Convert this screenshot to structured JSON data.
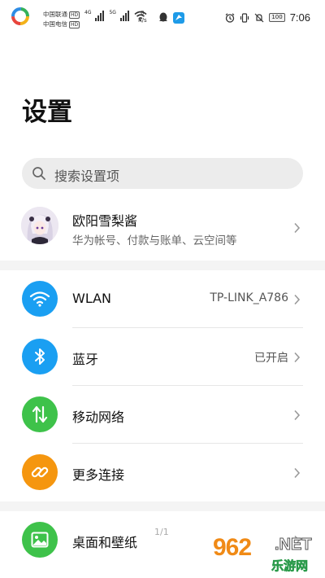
{
  "status_bar": {
    "carrier1": "中国联通",
    "carrier2": "中国电信",
    "hd": "HD",
    "net1": "4G",
    "net2": "5G",
    "speed_value": "0",
    "speed_unit": "K/s",
    "battery": "100",
    "time": "7:06"
  },
  "page": {
    "title": "设置"
  },
  "search": {
    "placeholder": "搜索设置项"
  },
  "account": {
    "name": "欧阳雪梨酱",
    "subtitle": "华为帐号、付款与账单、云空间等"
  },
  "rows": [
    {
      "label": "WLAN",
      "value": "TP-LINK_A786",
      "icon": "wifi-icon",
      "color": "#1a9ff2"
    },
    {
      "label": "蓝牙",
      "value": "已开启",
      "icon": "bluetooth-icon",
      "color": "#1a9ff2"
    },
    {
      "label": "移动网络",
      "value": "",
      "icon": "mobile-data-icon",
      "color": "#3ec24a"
    },
    {
      "label": "更多连接",
      "value": "",
      "icon": "link-icon",
      "color": "#f5960f"
    },
    {
      "label": "桌面和壁纸",
      "value": "",
      "icon": "wallpaper-icon",
      "color": "#3ec24a"
    }
  ],
  "page_indicator": "1/1",
  "watermark": {
    "brand": "962",
    "suffix": ".NET",
    "site": "乐游网"
  }
}
